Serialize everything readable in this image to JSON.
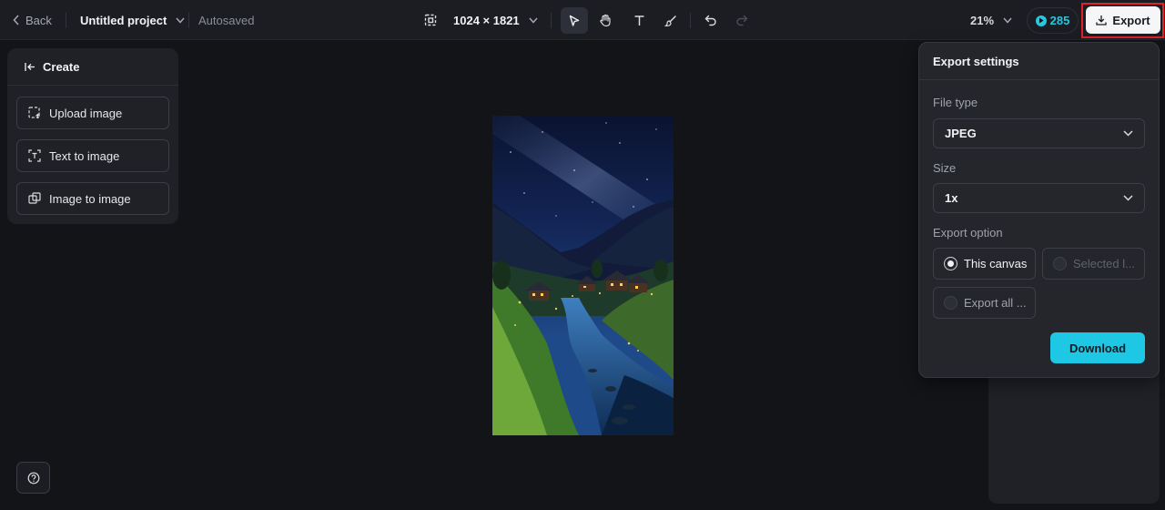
{
  "topbar": {
    "back_label": "Back",
    "project_title": "Untitled project",
    "autosave_status": "Autosaved",
    "canvas_size": "1024 × 1821",
    "tools": [
      "select-tool",
      "hand-tool",
      "text-tool",
      "brush-tool",
      "undo",
      "redo"
    ],
    "zoom": "21%",
    "credits": "285",
    "export_label": "Export"
  },
  "create_panel": {
    "title": "Create",
    "buttons": [
      "Upload image",
      "Text to image",
      "Image to image"
    ]
  },
  "export_panel": {
    "title": "Export settings",
    "file_type_label": "File type",
    "file_type_value": "JPEG",
    "size_label": "Size",
    "size_value": "1x",
    "export_option_label": "Export option",
    "options": {
      "this_canvas": "This canvas",
      "selected": "Selected l...",
      "export_all": "Export all ..."
    },
    "selected_option": "This canvas",
    "download_label": "Download"
  },
  "colors": {
    "accent": "#1ec7e3",
    "highlight_frame": "#e0212b",
    "background": "#131418"
  }
}
